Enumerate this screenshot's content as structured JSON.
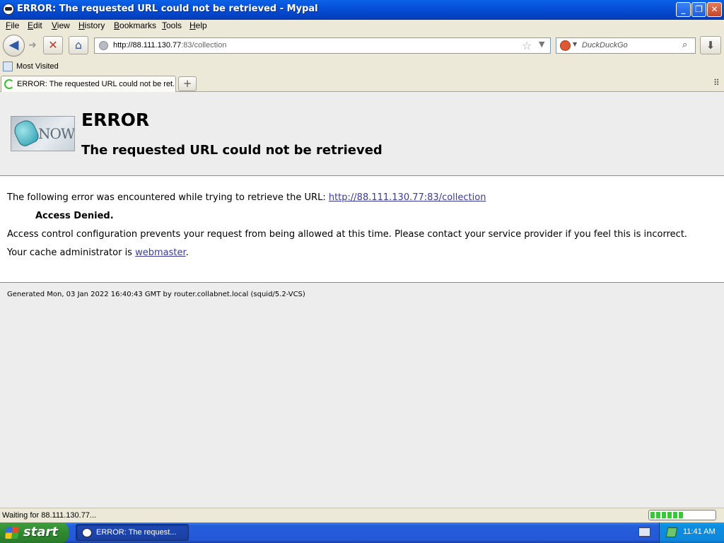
{
  "window": {
    "title": "ERROR: The requested URL could not be retrieved - Mypal",
    "controls": {
      "minimize": "_",
      "restore": "❐",
      "close": "✕"
    }
  },
  "menu": [
    "File",
    "Edit",
    "View",
    "History",
    "Bookmarks",
    "Tools",
    "Help"
  ],
  "nav": {
    "url_host": "http://88.111.130.77",
    "url_rest": ":83/collection",
    "search_placeholder": "DuckDuckGo",
    "icons": [
      "back-icon",
      "forward-icon",
      "stop-icon",
      "home-icon",
      "globe-icon",
      "bookmark-star-icon",
      "dropdown-icon",
      "duckduckgo-icon",
      "search-icon",
      "download-icon"
    ]
  },
  "bookmarks": {
    "most_visited": "Most Visited"
  },
  "tabs": {
    "active_label": "ERROR: The requested URL could not be ret...",
    "new_tab": "+",
    "tabs_menu": "⠿"
  },
  "page": {
    "logo_text": "NOW",
    "heading": "ERROR",
    "subheading": "The requested URL could not be retrieved",
    "intro": "The following error was encountered while trying to retrieve the URL:",
    "error_url": "http://88.111.130.77:83/collection",
    "denied": "Access Denied.",
    "explanation": "Access control configuration prevents your request from being allowed at this time. Please contact your service provider if you feel this is incorrect.",
    "admin_prefix": "Your cache administrator is",
    "admin_link": "webmaster",
    "admin_suffix": ".",
    "footer": "Generated Mon, 03 Jan 2022 16:40:43 GMT by router.collabnet.local (squid/5.2-VCS)"
  },
  "status": {
    "text": "Waiting for 88.111.130.77...",
    "progress_fraction": 0.52
  },
  "taskbar": {
    "start_label": "start",
    "task_label": "ERROR: The request...",
    "clock": "11:41 AM"
  }
}
